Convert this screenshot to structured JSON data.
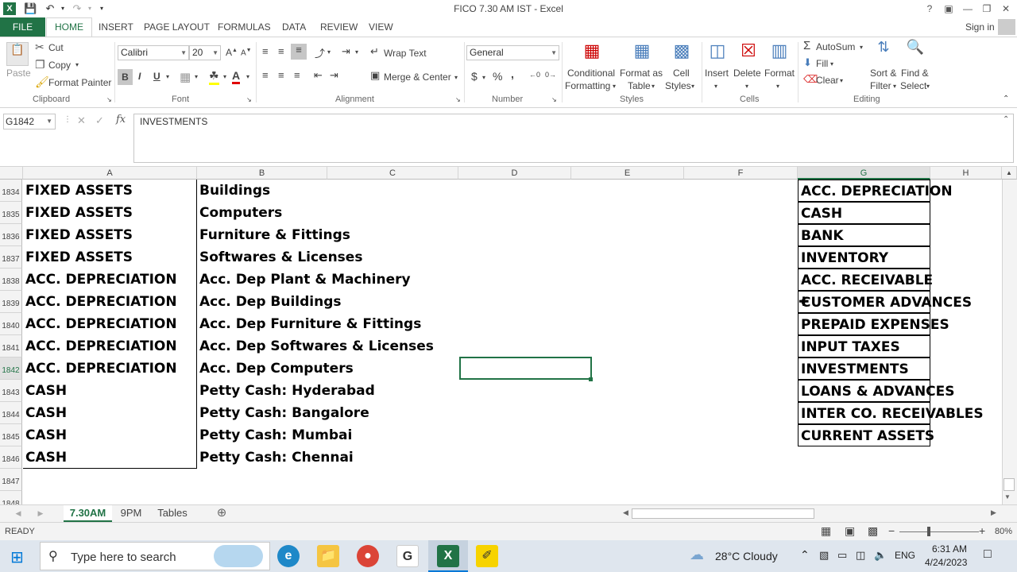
{
  "window": {
    "title": "FICO 7.30 AM IST - Excel",
    "help": "?",
    "sign_in": "Sign in"
  },
  "ribbon_tabs": {
    "file": "FILE",
    "home": "HOME",
    "insert": "INSERT",
    "page_layout": "PAGE LAYOUT",
    "formulas": "FORMULAS",
    "data": "DATA",
    "review": "REVIEW",
    "view": "VIEW"
  },
  "clipboard": {
    "paste": "Paste",
    "cut": "Cut",
    "copy": "Copy",
    "format_painter": "Format Painter",
    "label": "Clipboard"
  },
  "font": {
    "name": "Calibri",
    "size": "20",
    "bold": "B",
    "italic": "I",
    "underline": "U",
    "label": "Font"
  },
  "alignment": {
    "wrap_text": "Wrap Text",
    "merge_center": "Merge & Center",
    "label": "Alignment"
  },
  "number": {
    "format": "General",
    "currency": "$",
    "percent": "%",
    "comma": ",",
    "label": "Number"
  },
  "styles": {
    "conditional": "Conditional",
    "formatting": "Formatting",
    "format_as": "Format as",
    "table": "Table",
    "cell": "Cell",
    "cell_styles": "Styles",
    "label": "Styles"
  },
  "cells": {
    "insert": "Insert",
    "delete": "Delete",
    "format": "Format",
    "label": "Cells"
  },
  "editing": {
    "autosum": "AutoSum",
    "fill": "Fill",
    "clear": "Clear",
    "sort_filter_1": "Sort &",
    "sort_filter_2": "Filter",
    "find_select_1": "Find &",
    "find_select_2": "Select",
    "label": "Editing"
  },
  "formula_bar": {
    "name_box": "G1842",
    "fx": "fx",
    "value": "INVESTMENTS"
  },
  "columns": [
    "A",
    "B",
    "C",
    "D",
    "E",
    "F",
    "G",
    "H"
  ],
  "rows": [
    {
      "num": "1834",
      "a": "FIXED ASSETS",
      "b": "Buildings",
      "g": "ACC. DEPRECIATION"
    },
    {
      "num": "1835",
      "a": "FIXED ASSETS",
      "b": "Computers",
      "g": "CASH"
    },
    {
      "num": "1836",
      "a": "FIXED ASSETS",
      "b": "Furniture & Fittings",
      "g": "BANK"
    },
    {
      "num": "1837",
      "a": "FIXED ASSETS",
      "b": "Softwares & Licenses",
      "g": "INVENTORY"
    },
    {
      "num": "1838",
      "a": "ACC. DEPRECIATION",
      "b": "Acc. Dep Plant & Machinery",
      "g": "ACC. RECEIVABLE"
    },
    {
      "num": "1839",
      "a": "ACC. DEPRECIATION",
      "b": "Acc. Dep Buildings",
      "g": "CUSTOMER ADVANCES"
    },
    {
      "num": "1840",
      "a": "ACC. DEPRECIATION",
      "b": "Acc. Dep Furniture & Fittings",
      "g": "PREPAID EXPENSES"
    },
    {
      "num": "1841",
      "a": "ACC. DEPRECIATION",
      "b": "Acc. Dep Softwares & Licenses",
      "g": "INPUT TAXES"
    },
    {
      "num": "1842",
      "a": "ACC. DEPRECIATION",
      "b": "Acc. Dep Computers",
      "g": "INVESTMENTS"
    },
    {
      "num": "1843",
      "a": "CASH",
      "b": "Petty Cash: Hyderabad",
      "g": "LOANS & ADVANCES"
    },
    {
      "num": "1844",
      "a": "CASH",
      "b": "Petty Cash: Bangalore",
      "g": "INTER CO. RECEIVABLES"
    },
    {
      "num": "1845",
      "a": "CASH",
      "b": "Petty Cash: Mumbai",
      "g": "CURRENT ASSETS"
    },
    {
      "num": "1846",
      "a": "CASH",
      "b": "Petty Cash: Chennai",
      "g": ""
    },
    {
      "num": "1847",
      "a": "",
      "b": "",
      "g": ""
    },
    {
      "num": "1848",
      "a": "",
      "b": "",
      "g": ""
    }
  ],
  "sheets": [
    "7.30AM",
    "9PM",
    "Tables"
  ],
  "status": {
    "ready": "READY",
    "zoom": "80%"
  },
  "taskbar": {
    "search_placeholder": "Type here to search",
    "weather": "28°C  Cloudy",
    "language": "ENG",
    "time": "6:31 AM",
    "date": "4/24/2023"
  },
  "colors": {
    "excel_green": "#217346",
    "grid_line": "#d4d4d4"
  }
}
